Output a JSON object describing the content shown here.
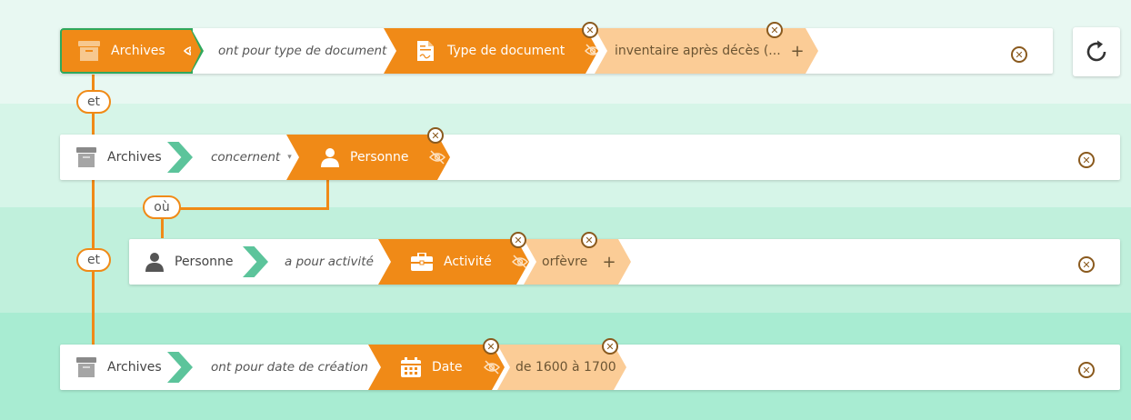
{
  "rows": [
    {
      "subject": "Archives",
      "predicate": "ont pour type de document",
      "object": "Type de document",
      "value": "inventaire après décès (...",
      "add": "+"
    },
    {
      "subject": "Archives",
      "predicate": "concernent",
      "object": "Personne"
    },
    {
      "subject": "Personne",
      "predicate": "a pour activité",
      "object": "Activité",
      "value": "orfèvre",
      "add": "+"
    },
    {
      "subject": "Archives",
      "predicate": "ont pour date de création",
      "object": "Date",
      "value": "de 1600 à 1700"
    }
  ],
  "connectors": {
    "and1": "et",
    "where": "où",
    "and2": "et"
  },
  "icons": {
    "archive": "archive-box-icon",
    "document": "document-icon",
    "person": "person-icon",
    "briefcase": "briefcase-icon",
    "calendar": "calendar-icon",
    "eye": "eye-icon",
    "eye_off": "eye-off-icon",
    "close": "close-circle-icon",
    "refresh": "refresh-icon"
  },
  "colors": {
    "accent": "#f08a17",
    "accent_pale": "#fbcc96",
    "arrow_green": "#5cc49b",
    "selected_border": "#2fa85c",
    "close": "#8a5a1e"
  }
}
